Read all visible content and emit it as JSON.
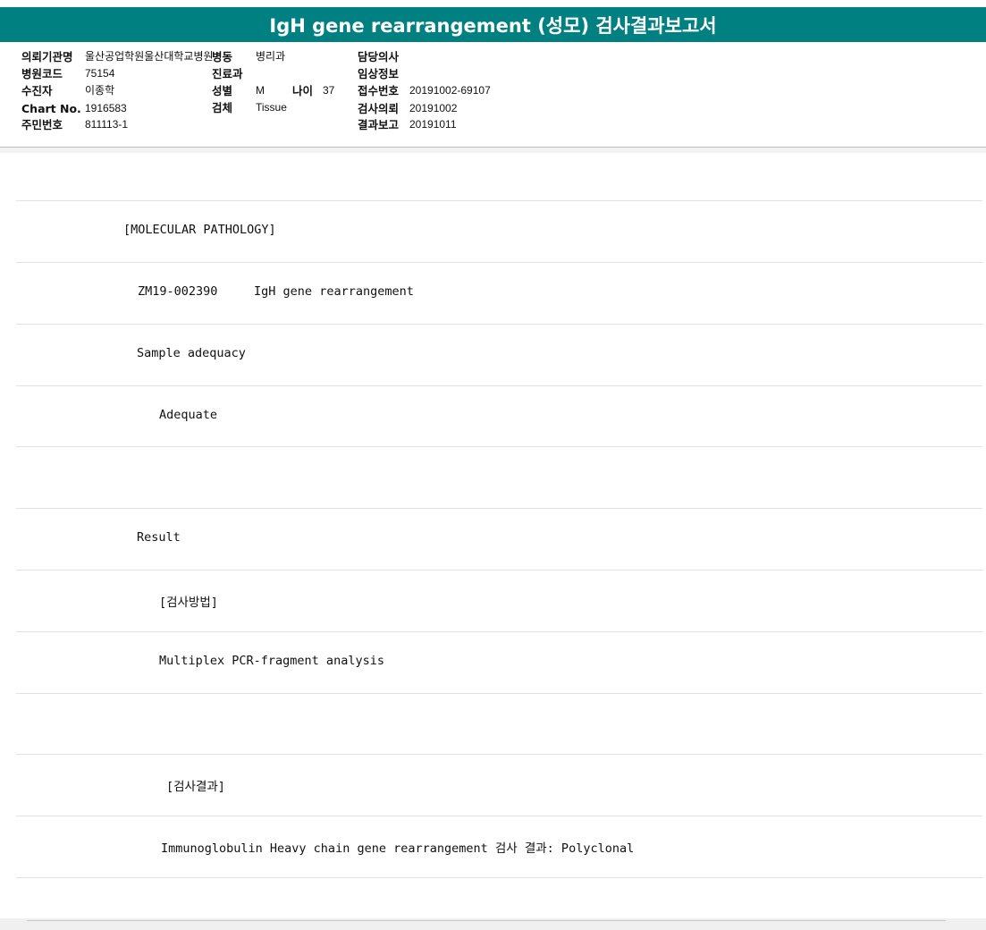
{
  "title": "IgH gene rearrangement (성모) 검사결과보고서",
  "header": {
    "referring_institution_label": "의뢰기관명",
    "referring_institution": "울산공업학원울산대학교병원",
    "ward_label": "병동",
    "ward": "병리과",
    "attending_label": "담당의사",
    "attending": "",
    "hospital_code_label": "병원코드",
    "hospital_code": "75154",
    "department_label": "진료과",
    "department": "",
    "clinical_info_label": "임상정보",
    "clinical_info": "",
    "patient_label": "수진자",
    "patient": "이종학",
    "sex_label": "성별",
    "sex": "M",
    "age_label": "나이",
    "age": "37",
    "receipt_no_label": "접수번호",
    "receipt_no": "20191002-69107",
    "chart_no_label": "Chart No.",
    "chart_no": "1916583",
    "specimen_label": "검체",
    "specimen": "Tissue",
    "request_date_label": "검사의뢰",
    "request_date": "20191002",
    "resident_no_label": "주민번호",
    "resident_no": "811113-1",
    "report_date_label": "결과보고",
    "report_date": "20191011"
  },
  "report_lines": [
    "",
    "[MOLECULAR PATHOLOGY]",
    "ZM19-002390     IgH gene rearrangement",
    "Sample adequacy",
    "Adequate",
    "",
    "Result",
    "[검사방법]",
    "Multiplex PCR-fragment analysis",
    "",
    "[검사결과]",
    "Immunoglobulin Heavy chain gene rearrangement 검사 결과: Polyclonal",
    ""
  ]
}
